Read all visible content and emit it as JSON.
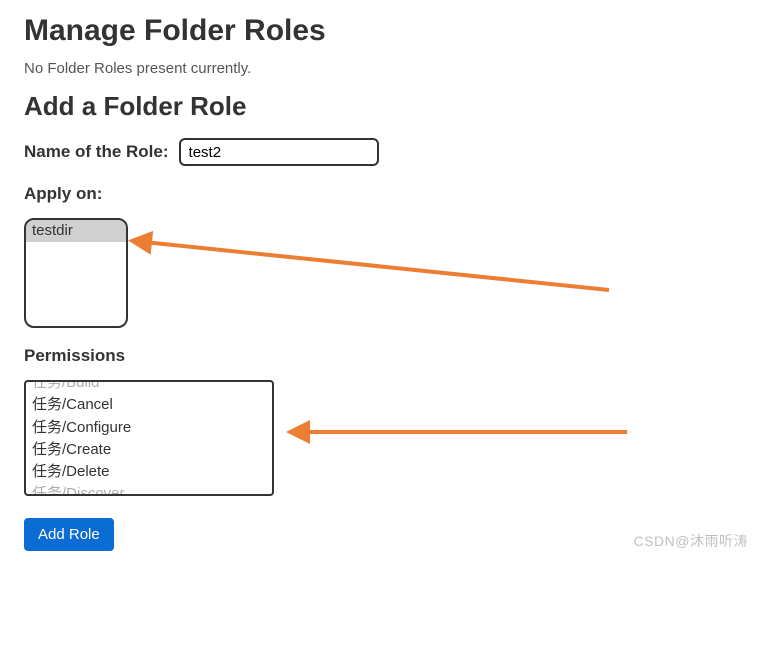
{
  "heading_manage": "Manage Folder Roles",
  "empty_message": "No Folder Roles present currently.",
  "heading_add": "Add a Folder Role",
  "name_label": "Name of the Role:",
  "name_value": "test2",
  "apply_label": "Apply on:",
  "apply_options": [
    {
      "label": "testdir",
      "selected": true
    }
  ],
  "permissions_label": "Permissions",
  "permissions_options": [
    {
      "label": "任务/Build",
      "faded": true
    },
    {
      "label": "任务/Cancel"
    },
    {
      "label": "任务/Configure"
    },
    {
      "label": "任务/Create"
    },
    {
      "label": "任务/Delete"
    },
    {
      "label": "任务/Discover",
      "faded": true
    }
  ],
  "submit_label": "Add Role",
  "watermark": "CSDN@沐雨听涛",
  "arrow_color": "#ed7d31"
}
